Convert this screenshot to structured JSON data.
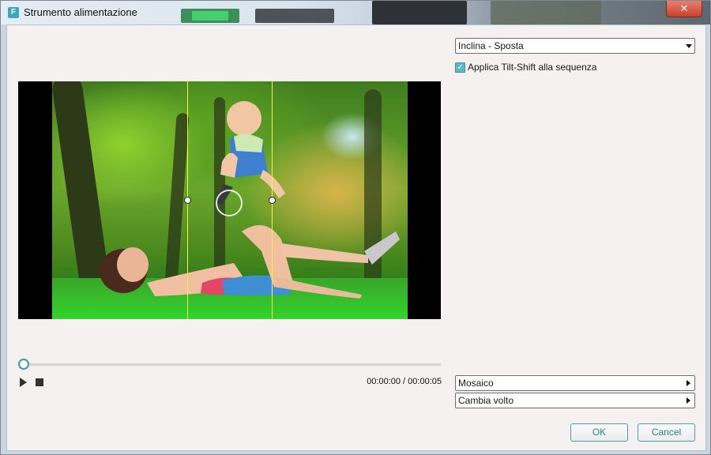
{
  "window": {
    "title": "Strumento alimentazione",
    "app_icon_letter": "F",
    "close_label": "✕"
  },
  "preview": {
    "image_description_icon": "photo-icon"
  },
  "player": {
    "timecode": "00:00:00 / 00:00:05",
    "progress_fraction": 0
  },
  "effect_select": {
    "value": "Inclina - Sposta"
  },
  "apply_checkbox": {
    "checked": true,
    "label": "Applica Tilt-Shift alla sequenza"
  },
  "expanders": [
    {
      "label": "Mosaico"
    },
    {
      "label": "Cambia volto"
    }
  ],
  "buttons": {
    "ok": "OK",
    "cancel": "Cancel"
  },
  "colors": {
    "accent": "#3e9aa8",
    "guide_line": "#f2f24a"
  }
}
